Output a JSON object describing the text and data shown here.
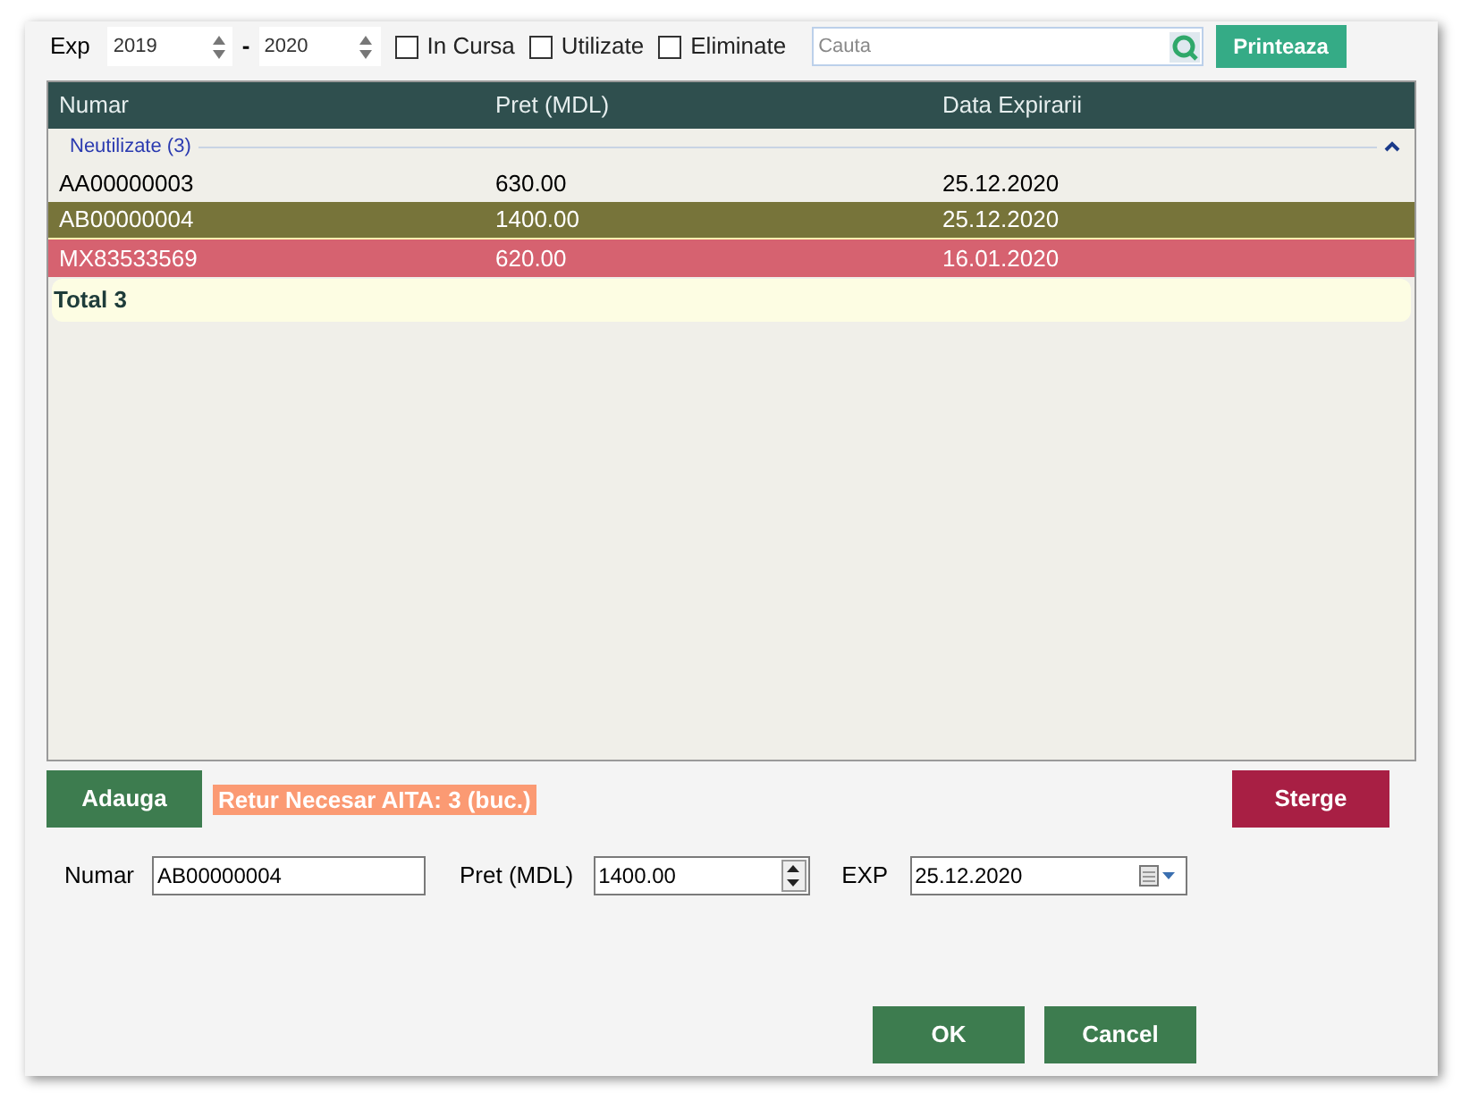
{
  "toolbar": {
    "exp_label": "Exp",
    "year_from": "2019",
    "dash": "-",
    "year_to": "2020",
    "filters": [
      {
        "label": "In Cursa",
        "checked": false
      },
      {
        "label": "Utilizate",
        "checked": false
      },
      {
        "label": "Eliminate",
        "checked": false
      }
    ],
    "search": {
      "placeholder": "Cauta"
    },
    "print_button": "Printeaza"
  },
  "table": {
    "columns": [
      "Numar",
      "Pret (MDL)",
      "Data Expirarii"
    ],
    "group": {
      "label": "Neutilizate (3)",
      "expanded": true
    },
    "rows": [
      {
        "cells": [
          "AA00000003",
          "630.00",
          "25.12.2020"
        ],
        "selected": false,
        "expired": false
      },
      {
        "cells": [
          "AB00000004",
          "1400.00",
          "25.12.2020"
        ],
        "selected": true,
        "expired": false
      },
      {
        "cells": [
          "MX83533569",
          "620.00",
          "16.01.2020"
        ],
        "selected": false,
        "expired": true
      }
    ],
    "total": "Total 3"
  },
  "actions": {
    "add_button": "Adauga",
    "notice": "Retur Necesar AITA: 3 (buc.)",
    "delete_button": "Sterge"
  },
  "form": {
    "numar_label": "Numar",
    "numar_value": "AB00000004",
    "pret_label": "Pret (MDL)",
    "pret_value": "1400.00",
    "exp_label": "EXP",
    "exp_value": "25.12.2020"
  },
  "buttons": [
    "OK",
    "Cancel"
  ]
}
